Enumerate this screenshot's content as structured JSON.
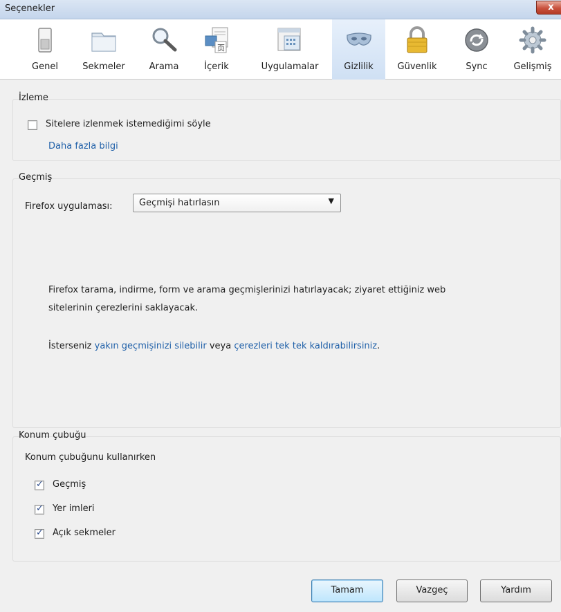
{
  "window": {
    "title": "Seçenekler",
    "close_label": "x"
  },
  "toolbar": {
    "tabs": [
      {
        "label": "Genel",
        "icon": "switch-icon"
      },
      {
        "label": "Sekmeler",
        "icon": "folder-tabs-icon"
      },
      {
        "label": "Arama",
        "icon": "magnifier-icon"
      },
      {
        "label": "İçerik",
        "icon": "content-document-icon"
      },
      {
        "label": "Uygulamalar",
        "icon": "applications-icon"
      },
      {
        "label": "Gizlilik",
        "icon": "mask-icon"
      },
      {
        "label": "Güvenlik",
        "icon": "padlock-icon"
      },
      {
        "label": "Sync",
        "icon": "sync-icon"
      },
      {
        "label": "Gelişmiş",
        "icon": "gear-icon"
      }
    ],
    "selected": "Gizlilik"
  },
  "tracking": {
    "title": "İzleme",
    "dnt_label": "Sitelere izlenmek istemediğimi söyle",
    "dnt_checked": false,
    "more_info": "Daha fazla bilgi"
  },
  "history": {
    "title": "Geçmiş",
    "firefox_label": "Firefox uygulaması:",
    "select_value": "Geçmişi hatırlasın",
    "desc_line1": "Firefox tarama, indirme, form ve arama geçmişlerinizi hatırlayacak; ziyaret ettiğiniz web",
    "desc_line2": "sitelerinin çerezlerini saklayacak.",
    "prefix": "İsterseniz ",
    "link1": "yakın geçmişinizi silebilir",
    "middle": " veya ",
    "link2": "çerezleri tek tek kaldırabilirsiniz",
    "suffix": "."
  },
  "location_bar": {
    "title": "Konum çubuğu",
    "subtitle": "Konum çubuğunu kullanırken",
    "options": [
      {
        "label": "Geçmiş",
        "checked": true
      },
      {
        "label": "Yer imleri",
        "checked": true
      },
      {
        "label": "Açık sekmeler",
        "checked": true
      }
    ]
  },
  "buttons": {
    "ok": "Tamam",
    "cancel": "Vazgeç",
    "help": "Yardım"
  },
  "colors": {
    "link": "#2161a9",
    "selected_tab": "#cfe0f4"
  }
}
